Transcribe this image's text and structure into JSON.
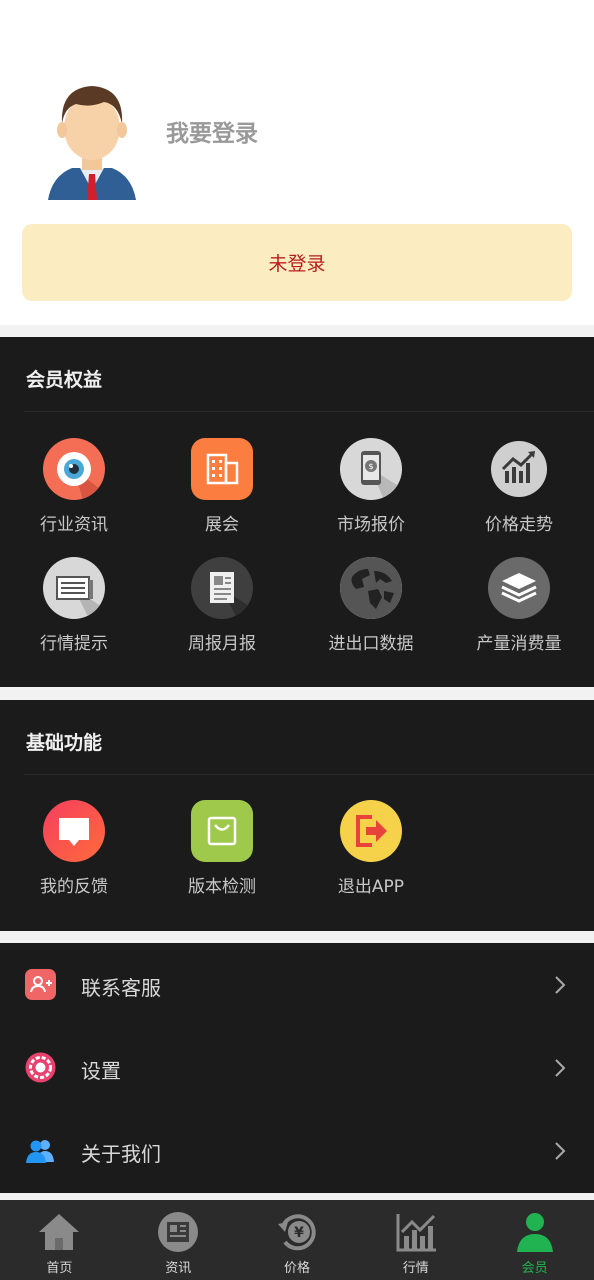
{
  "profile": {
    "login_text": "我要登录",
    "status": "未登录"
  },
  "benefits": {
    "title": "会员权益",
    "items": [
      {
        "label": "行业资讯",
        "icon": "eye-icon"
      },
      {
        "label": "展会",
        "icon": "building-icon"
      },
      {
        "label": "市场报价",
        "icon": "phone-price-icon"
      },
      {
        "label": "价格走势",
        "icon": "trend-chart-icon"
      },
      {
        "label": "行情提示",
        "icon": "newspaper-icon"
      },
      {
        "label": "周报月报",
        "icon": "report-icon"
      },
      {
        "label": "进出口数据",
        "icon": "globe-icon"
      },
      {
        "label": "产量消费量",
        "icon": "layers-icon"
      }
    ]
  },
  "basic": {
    "title": "基础功能",
    "items": [
      {
        "label": "我的反馈",
        "icon": "feedback-icon"
      },
      {
        "label": "版本检测",
        "icon": "bag-icon"
      },
      {
        "label": "退出APP",
        "icon": "exit-icon"
      }
    ]
  },
  "list": [
    {
      "label": "联系客服",
      "icon": "customer-service-icon"
    },
    {
      "label": "设置",
      "icon": "settings-icon"
    },
    {
      "label": "关于我们",
      "icon": "about-us-icon"
    }
  ],
  "tabs": [
    {
      "label": "首页",
      "icon": "home-icon"
    },
    {
      "label": "资讯",
      "icon": "news-icon"
    },
    {
      "label": "价格",
      "icon": "price-icon"
    },
    {
      "label": "行情",
      "icon": "market-icon"
    },
    {
      "label": "会员",
      "icon": "member-icon"
    }
  ],
  "colors": {
    "accent": "#21b352",
    "status_bg": "#fbecc1",
    "status_text": "#b81e1e",
    "section_bg": "#1b1b1b"
  }
}
